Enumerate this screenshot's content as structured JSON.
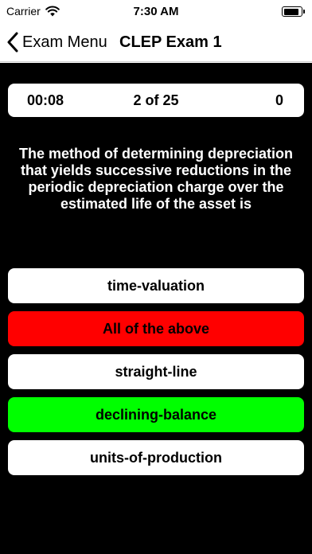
{
  "status": {
    "carrier": "Carrier",
    "time": "7:30 AM",
    "battery_level": 0.9
  },
  "nav": {
    "back_label": "Exam Menu",
    "title": "CLEP Exam 1"
  },
  "score_bar": {
    "timer": "00:08",
    "progress": "2 of 25",
    "score": "0"
  },
  "question": "The method of determining depreciation that yields successive reductions in the periodic depreciation charge over the estimated life of the asset is",
  "answers": [
    {
      "label": "time-valuation",
      "state": "neutral",
      "color": "#ffffff"
    },
    {
      "label": "All of the above",
      "state": "incorrect",
      "color": "#ff0000"
    },
    {
      "label": "straight-line",
      "state": "neutral",
      "color": "#ffffff"
    },
    {
      "label": "declining-balance",
      "state": "correct",
      "color": "#00ff00"
    },
    {
      "label": "units-of-production",
      "state": "neutral",
      "color": "#ffffff"
    }
  ],
  "icons": {
    "wifi": "wifi-icon",
    "battery": "battery-icon",
    "back": "chevron-left-icon"
  }
}
